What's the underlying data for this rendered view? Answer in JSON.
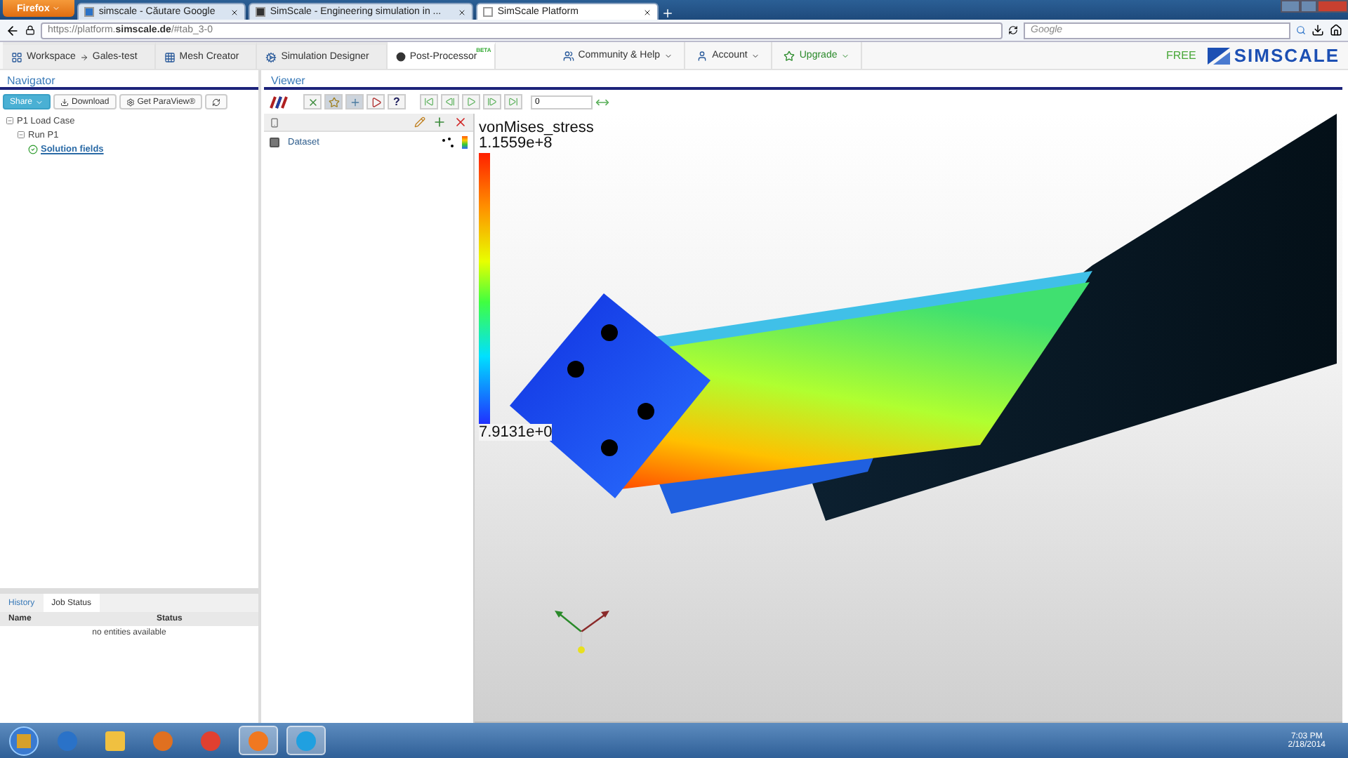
{
  "browser": {
    "menu_button": "Firefox",
    "tabs": [
      {
        "title": "simscale - Căutare Google",
        "selected": false
      },
      {
        "title": "SimScale - Engineering simulation in ...",
        "selected": false
      },
      {
        "title": "SimScale Platform",
        "selected": true
      }
    ],
    "url_host": "https://platform.",
    "url_domain": "simscale.de",
    "url_path": "/#tab_3-0",
    "search_placeholder": "Google"
  },
  "app_nav": {
    "items": [
      {
        "label": "Workspace",
        "crumb": "Gales-test",
        "kind": "workspace",
        "selected": false
      },
      {
        "label": "Mesh Creator",
        "kind": "mesh",
        "selected": false
      },
      {
        "label": "Simulation Designer",
        "kind": "sim",
        "selected": false
      },
      {
        "label": "Post-Processor",
        "kind": "post",
        "badge": "BETA",
        "selected": true
      }
    ],
    "menus": [
      {
        "label": "Community & Help",
        "kind": "community"
      },
      {
        "label": "Account",
        "kind": "account"
      },
      {
        "label": "Upgrade",
        "kind": "upgrade"
      }
    ],
    "plan": "FREE",
    "logo_text": "SIMSCALE"
  },
  "navigator": {
    "title": "Navigator",
    "buttons": [
      {
        "label": "Share",
        "kind": "share"
      },
      {
        "label": "Download",
        "kind": "download"
      },
      {
        "label": "Get ParaView®",
        "kind": "paraview"
      },
      {
        "kind": "refresh"
      }
    ],
    "tree": [
      {
        "label": "P1 Load Case",
        "expanded": true,
        "children": [
          {
            "label": "Run P1",
            "expanded": true,
            "children": [
              {
                "label": "Solution fields",
                "kind": "result"
              }
            ]
          }
        ]
      }
    ]
  },
  "bottom_panel": {
    "tabs": [
      {
        "label": "History",
        "selected": false
      },
      {
        "label": "Job Status",
        "selected": true
      }
    ],
    "columns": [
      "Name",
      "Status"
    ],
    "empty_message": "no entities available"
  },
  "viewer": {
    "title": "Viewer",
    "tools": [
      {
        "pressed": false
      },
      {
        "pressed": true
      },
      {
        "pressed": true
      },
      {
        "pressed": false
      },
      {
        "pressed": false,
        "label": "?"
      }
    ],
    "frame": "0",
    "pipeline": [
      {
        "label": "Dataset",
        "visible": false
      }
    ],
    "legend": {
      "title": "vonMises_stress",
      "max": "1.1559e+8",
      "min": "7.9131e+0"
    }
  },
  "taskbar": {
    "apps": [
      {
        "running": false
      },
      {
        "running": false
      },
      {
        "running": false
      },
      {
        "running": false
      },
      {
        "running": true
      },
      {
        "running": true
      }
    ],
    "time": "7:03 PM",
    "date": "2/18/2014"
  }
}
